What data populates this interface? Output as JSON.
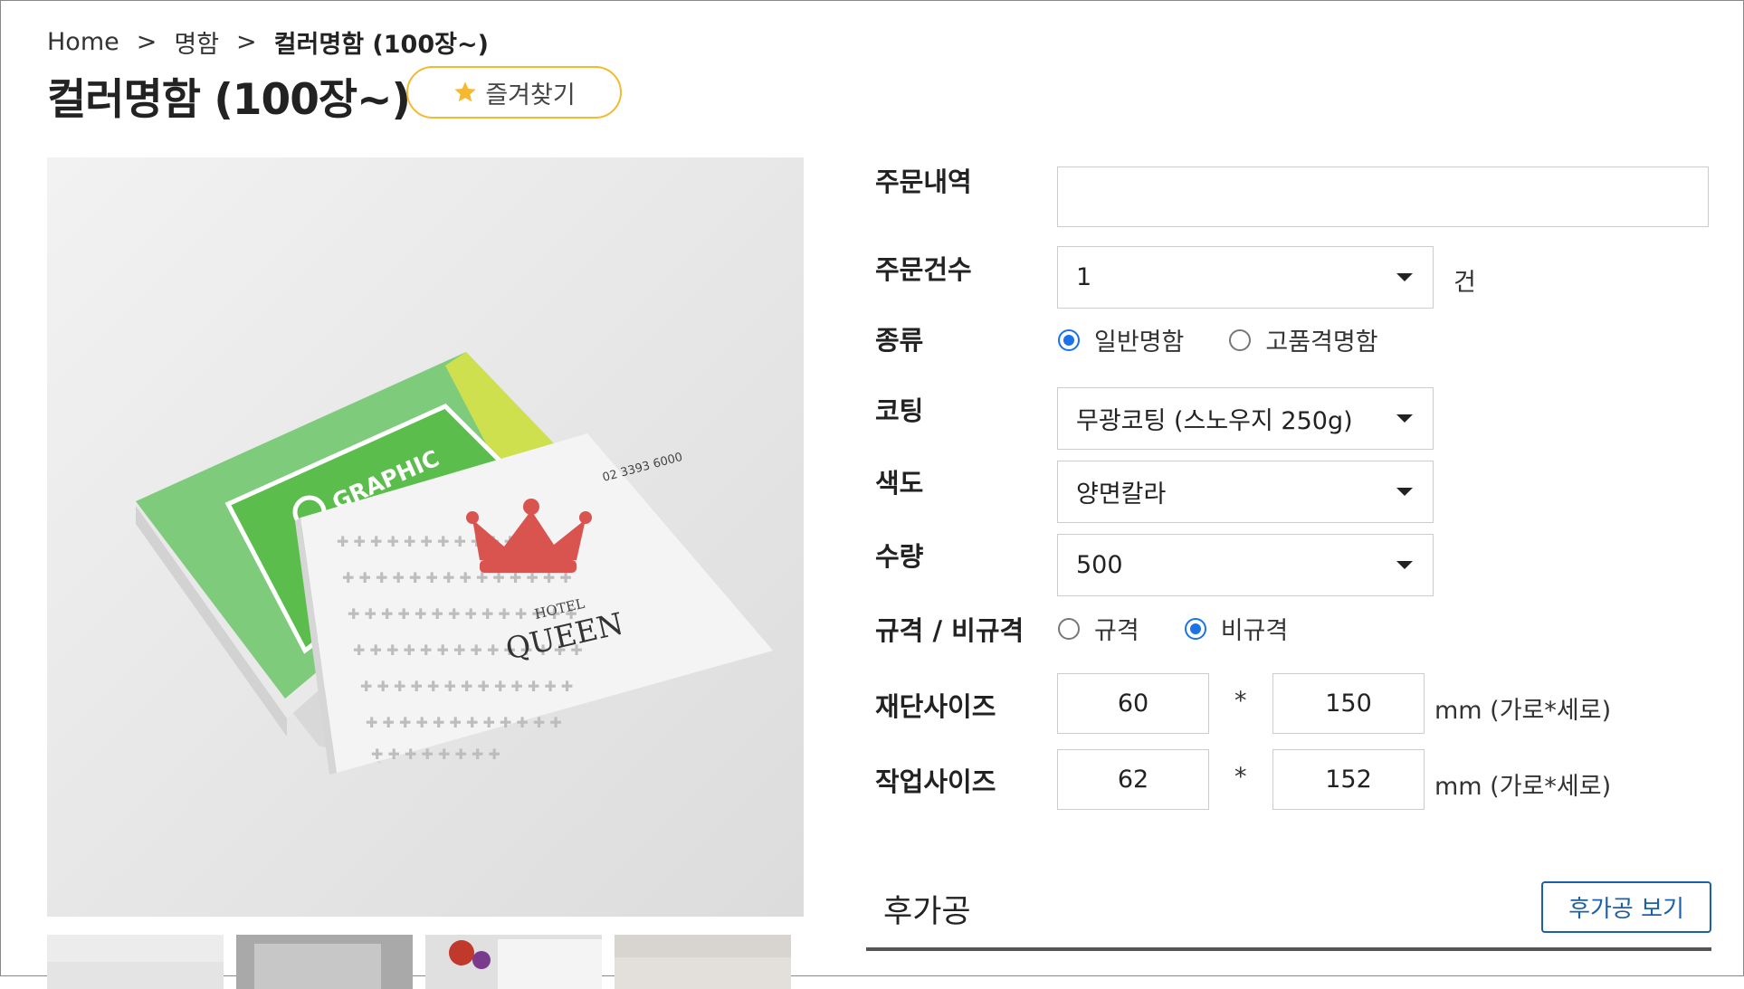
{
  "breadcrumb": {
    "home": "Home",
    "sep1": ">",
    "category": "명함",
    "sep2": ">",
    "current": "컬러명함 (100장~)"
  },
  "page": {
    "title": "컬러명함 (100장~)",
    "favorite_label": "즐겨찾기"
  },
  "product_image": {
    "brand_text": "GRAPHIC",
    "phone_text": "02 3393 6000",
    "hotel_text": "HOTEL",
    "queen_text": "QUEEN"
  },
  "form": {
    "order_history": {
      "label": "주문내역",
      "value": ""
    },
    "order_count": {
      "label": "주문건수",
      "value": "1",
      "unit": "건"
    },
    "type": {
      "label": "종류",
      "options": [
        "일반명함",
        "고품격명함"
      ],
      "selected": 0
    },
    "coating": {
      "label": "코팅",
      "value": "무광코팅 (스노우지 250g)"
    },
    "color": {
      "label": "색도",
      "value": "양면칼라"
    },
    "quantity": {
      "label": "수량",
      "value": "500"
    },
    "spec": {
      "label": "규격 / 비규격",
      "options": [
        "규격",
        "비규격"
      ],
      "selected": 1
    },
    "cut_size": {
      "label": "재단사이즈",
      "width": "60",
      "height": "150",
      "times": "*",
      "unit": "mm (가로*세로)"
    },
    "work_size": {
      "label": "작업사이즈",
      "width": "62",
      "height": "152",
      "times": "*",
      "unit": "mm (가로*세로)"
    }
  },
  "post_processing": {
    "title": "후가공",
    "button_label": "후가공 보기"
  },
  "colors": {
    "accent_blue": "#1a73e8",
    "button_blue": "#1d5fa8",
    "star": "#f5b82e",
    "card_green": "#7dc47a",
    "crown_red": "#d9534f"
  }
}
